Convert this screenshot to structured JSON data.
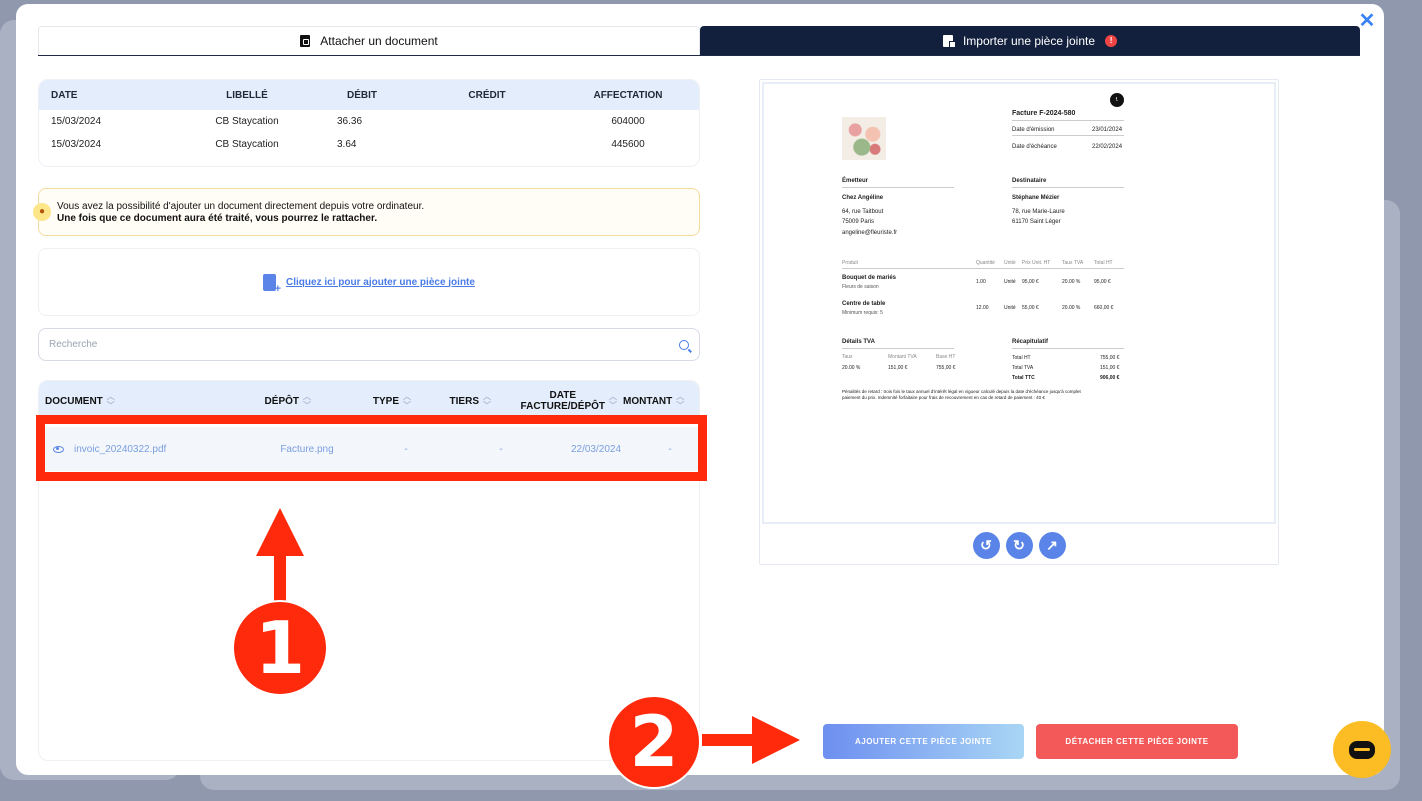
{
  "tabs": {
    "attach_label": "Attacher un document",
    "import_label": "Importer une pièce jointe",
    "import_badge": "!"
  },
  "transactions": {
    "headers": [
      "DATE",
      "LIBELLÉ",
      "DÉBIT",
      "CRÉDIT",
      "AFFECTATION"
    ],
    "rows": [
      {
        "date": "15/03/2024",
        "libelle": "CB Staycation",
        "debit": "36.36",
        "credit": "",
        "affectation": "604000"
      },
      {
        "date": "15/03/2024",
        "libelle": "CB Staycation",
        "debit": "3.64",
        "credit": "",
        "affectation": "445600"
      }
    ]
  },
  "info": {
    "line1": "Vous avez la possibilité d'ajouter un document directement depuis votre ordinateur.",
    "line2": "Une fois que ce document aura été traité, vous pourrez le rattacher."
  },
  "upload": {
    "link": "Cliquez ici pour ajouter une pièce jointe"
  },
  "search": {
    "placeholder": "Recherche"
  },
  "documents": {
    "headers": {
      "document": "DOCUMENT",
      "depot": "DÉPÔT",
      "type": "TYPE",
      "tiers": "TIERS",
      "date_l1": "DATE",
      "date_l2": "FACTURE/DÉPÔT",
      "montant": "MONTANT"
    },
    "rows": [
      {
        "document": "invoic_20240322.pdf",
        "depot": "Facture.png",
        "type": "-",
        "tiers": "-",
        "date": "22/03/2024",
        "montant": "-"
      }
    ]
  },
  "invoice": {
    "logo": "f.",
    "number": "Facture F-2024-580",
    "issue_label": "Date d'émission",
    "issue_date": "23/01/2024",
    "due_label": "Date d'échéance",
    "due_date": "22/02/2024",
    "issuer_title": "Émetteur",
    "issuer_name": "Chez Angéline",
    "issuer_addr1": "64, rue Taitbout",
    "issuer_addr2": "75009 Paris",
    "issuer_email": "angeline@fleuriste.fr",
    "recipient_title": "Destinataire",
    "recipient_name": "Stéphane Mézier",
    "recipient_addr1": "78, rue Marie-Laure",
    "recipient_addr2": "61170 Saint Léger",
    "cols": [
      "Produit",
      "Quantité",
      "Unité",
      "Prix Unit. HT",
      "Taux TVA",
      "Total HT"
    ],
    "items": [
      {
        "name": "Bouquet de mariés",
        "desc": "Fleurs de saison",
        "qty": "1.00",
        "unit": "Unité",
        "price": "95,00 €",
        "vat": "20.00 %",
        "total": "95,00 €"
      },
      {
        "name": "Centre de table",
        "desc": "Minimum requis: 5",
        "qty": "12.00",
        "unit": "Unité",
        "price": "55,00 €",
        "vat": "20.00 %",
        "total": "660,00 €"
      }
    ],
    "tva_title": "Détails TVA",
    "tva_cols": [
      "Taux",
      "Montant TVA",
      "Base HT"
    ],
    "tva_row": [
      "20.00 %",
      "151,00 €",
      "755,00 €"
    ],
    "recap_title": "Récapitulatif",
    "recap": [
      [
        "Total HT",
        "755,00 €"
      ],
      [
        "Total TVA",
        "151,00 €"
      ],
      [
        "Total TTC",
        "906,00 €"
      ]
    ],
    "penalty1": "Pénalités de retard : trois fois le taux annuel d'intérêt légal en vigueur calculé depuis la date d'échéance jusqu'à complet",
    "penalty2": "paiement du prix. Indemnité forfaitaire pour frais de recouvrement en cas de retard de paiement : 40 €"
  },
  "actions": {
    "add": "AJOUTER CETTE PIÈCE JOINTE",
    "detach": "DÉTACHER CETTE PIÈCE JOINTE"
  },
  "annotations": {
    "one": "1",
    "two": "2"
  },
  "colors": {
    "annotation": "#ff2a0c",
    "accent": "#5b84e8",
    "navy": "#12203d",
    "danger": "#f35959"
  },
  "icons": {
    "close": "close-icon",
    "rotate_left": "rotate-left-icon",
    "rotate_right": "rotate-right-icon",
    "open_external": "open-external-icon"
  }
}
